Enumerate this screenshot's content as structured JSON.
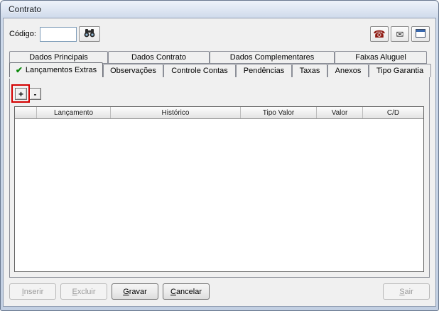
{
  "window": {
    "title": "Contrato"
  },
  "header": {
    "codigo_label": "Código:",
    "codigo_value": "",
    "icons": {
      "search": "binoculars",
      "phone": "☎",
      "mail": "✉",
      "form": "window-form"
    }
  },
  "tabs": {
    "row1": [
      {
        "label": "Dados Principais"
      },
      {
        "label": "Dados Contrato"
      },
      {
        "label": "Dados Complementares"
      },
      {
        "label": "Faixas Aluguel"
      }
    ],
    "row2": [
      {
        "label": "Lançamentos Extras",
        "active": true,
        "icon": "✔"
      },
      {
        "label": "Observações"
      },
      {
        "label": "Controle Contas"
      },
      {
        "label": "Pendências"
      },
      {
        "label": "Taxas"
      },
      {
        "label": "Anexos"
      },
      {
        "label": "Tipo Garantia"
      }
    ]
  },
  "toolbar": {
    "add_label": "+",
    "remove_label": "-"
  },
  "grid": {
    "columns": [
      "Lançamento",
      "Histórico",
      "Tipo Valor",
      "Valor",
      "C/D"
    ],
    "rows": []
  },
  "footer": {
    "buttons": [
      {
        "label": "Inserir",
        "enabled": false
      },
      {
        "label": "Excluir",
        "enabled": false
      },
      {
        "label": "Gravar",
        "enabled": true
      },
      {
        "label": "Cancelar",
        "enabled": true
      },
      {
        "label": "Sair",
        "enabled": false
      }
    ]
  },
  "annotation": {
    "color": "#d40000",
    "target": "add-button"
  }
}
